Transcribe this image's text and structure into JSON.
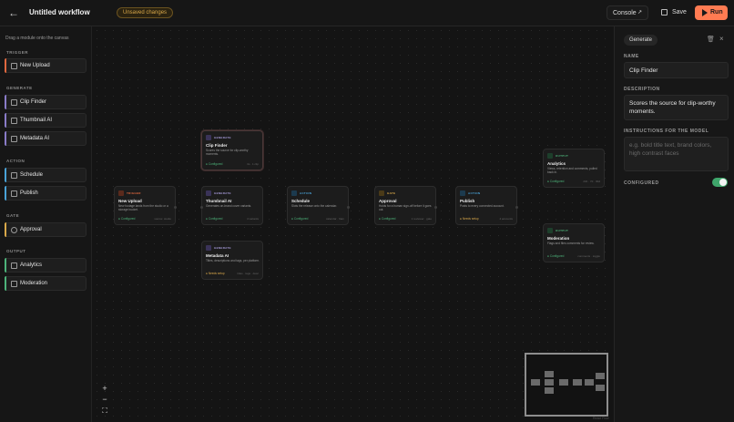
{
  "header": {
    "title": "Untitled workflow",
    "unsaved_badge": "Unsaved changes",
    "console_label": "Console",
    "save_label": "Save",
    "run_label": "Run"
  },
  "sidebar": {
    "hint": "Drag a module onto the canvas",
    "sections": {
      "trigger": "TRIGGER",
      "generate": "GENERATE",
      "action": "ACTION",
      "gate": "GATE",
      "output": "OUTPUT"
    },
    "modules": {
      "new_upload": "New Upload",
      "clip_finder": "Clip Finder",
      "thumbnail_ai": "Thumbnail AI",
      "metadata_ai": "Metadata AI",
      "schedule": "Schedule",
      "publish": "Publish",
      "approval": "Approval",
      "analytics": "Analytics",
      "moderation": "Moderation"
    }
  },
  "canvas": {
    "nodes": {
      "clip_finder": {
        "type": "GENERATE",
        "name": "Clip Finder",
        "desc": "Scores the source for clip-worthy moments.",
        "status": "Configured",
        "meta": "3s · 1 clip"
      },
      "new_upload": {
        "type": "TRIGGER",
        "name": "New Upload",
        "desc": "New footage lands from the studio or a storage bucket.",
        "status": "Configured",
        "meta": "source: studio"
      },
      "thumbnail_ai": {
        "type": "GENERATE",
        "name": "Thumbnail AI",
        "desc": "Generates on-brand cover variants.",
        "status": "Configured",
        "meta": "4 variants"
      },
      "metadata_ai": {
        "type": "GENERATE",
        "name": "Metadata AI",
        "desc": "Titles, descriptions and tags, per platform.",
        "status": "Needs setup",
        "meta": "titles · tags · desc"
      },
      "schedule": {
        "type": "ACTION",
        "name": "Schedule",
        "desc": "Slots the release onto the calendar.",
        "status": "Configured",
        "meta": "calendar · 9am"
      },
      "approval": {
        "type": "GATE",
        "name": "Approval",
        "desc": "Holds for a human sign-off before it goes out.",
        "status": "Configured",
        "meta": "1 reviewer · gate"
      },
      "publish": {
        "type": "ACTION",
        "name": "Publish",
        "desc": "Posts to every connected account.",
        "status": "Needs setup",
        "meta": "4 accounts"
      },
      "analytics": {
        "type": "OUTPUT",
        "name": "Analytics",
        "desc": "Views, retention and comments, pulled back in.",
        "status": "Configured",
        "meta": "24h · 7d · 30d"
      },
      "moderation": {
        "type": "OUTPUT",
        "name": "Moderation",
        "desc": "Flags and files comments for review.",
        "status": "Configured",
        "meta": "comments · toggle"
      }
    },
    "zoom_in": "+",
    "zoom_out": "−",
    "fit": "⛶",
    "credit": "React Flow"
  },
  "panel": {
    "tab": "Generate",
    "name_label": "NAME",
    "name_value": "Clip Finder",
    "description_label": "DESCRIPTION",
    "description_value": "Scores the source for clip-worthy moments.",
    "instructions_label": "INSTRUCTIONS FOR THE MODEL",
    "instructions_placeholder": "e.g. bold title text, brand colors, high contrast faces",
    "configured_label": "CONFIGURED",
    "configured": true
  },
  "colors": {
    "accent": "#ff7b52",
    "trigger": "#e0683f",
    "generate": "#8a7cc8",
    "action": "#4aa3d8",
    "gate": "#d9a84a",
    "output": "#4db37a",
    "configured": "#4db37a",
    "needs_setup": "#d9a84a"
  }
}
